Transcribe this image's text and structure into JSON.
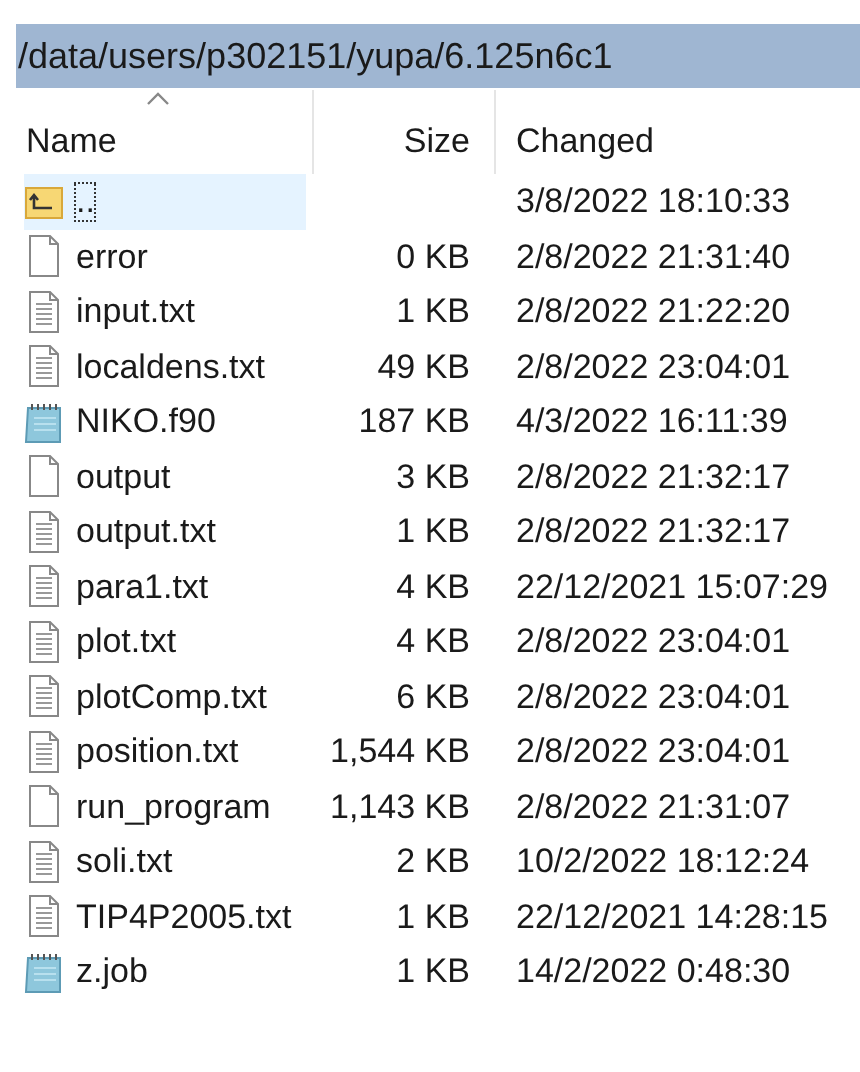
{
  "path_bar": {
    "text": "/data/users/p302151/yupa/6.125n6c1"
  },
  "columns": [
    {
      "label": "Name",
      "sorted": true
    },
    {
      "label": "Size",
      "sorted": false
    },
    {
      "label": "Changed",
      "sorted": false
    }
  ],
  "rows": [
    {
      "kind": "parent",
      "name": "..",
      "changed": "3/8/2022 18:10:33",
      "selected": true
    },
    {
      "kind": "blank",
      "name": "error",
      "size": "0 KB",
      "changed": "2/8/2022 21:31:40",
      "selected": false
    },
    {
      "kind": "text",
      "name": "input.txt",
      "size": "1 KB",
      "changed": "2/8/2022 21:22:20",
      "selected": false
    },
    {
      "kind": "text",
      "name": "localdens.txt",
      "size": "49 KB",
      "changed": "2/8/2022 23:04:01",
      "selected": false
    },
    {
      "kind": "notepad",
      "name": "NIKO.f90",
      "size": "187 KB",
      "changed": "4/3/2022 16:11:39",
      "selected": false
    },
    {
      "kind": "blank",
      "name": "output",
      "size": "3 KB",
      "changed": "2/8/2022 21:32:17",
      "selected": false
    },
    {
      "kind": "text",
      "name": "output.txt",
      "size": "1 KB",
      "changed": "2/8/2022 21:32:17",
      "selected": false
    },
    {
      "kind": "text",
      "name": "para1.txt",
      "size": "4 KB",
      "changed": "22/12/2021 15:07:29",
      "selected": false
    },
    {
      "kind": "text",
      "name": "plot.txt",
      "size": "4 KB",
      "changed": "2/8/2022 23:04:01",
      "selected": false
    },
    {
      "kind": "text",
      "name": "plotComp.txt",
      "size": "6 KB",
      "changed": "2/8/2022 23:04:01",
      "selected": false
    },
    {
      "kind": "text",
      "name": "position.txt",
      "size": "1,544 KB",
      "changed": "2/8/2022 23:04:01",
      "selected": false
    },
    {
      "kind": "blank",
      "name": "run_program",
      "size": "1,143 KB",
      "changed": "2/8/2022 21:31:07",
      "selected": false
    },
    {
      "kind": "text",
      "name": "soli.txt",
      "size": "2 KB",
      "changed": "10/2/2022 18:12:24",
      "selected": false
    },
    {
      "kind": "text",
      "name": "TIP4P2005.txt",
      "size": "1 KB",
      "changed": "22/12/2021 14:28:15",
      "selected": false
    },
    {
      "kind": "notepad",
      "name": "z.job",
      "size": "1 KB",
      "changed": "14/2/2022 0:48:30",
      "selected": false
    }
  ]
}
